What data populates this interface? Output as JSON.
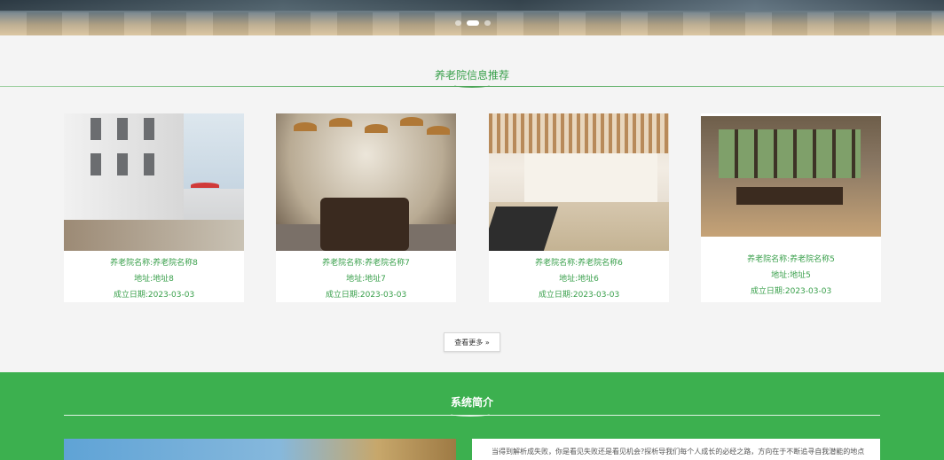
{
  "hero": {
    "slide_count": 3,
    "active_slide": 2
  },
  "recommend": {
    "title": "养老院信息推荐",
    "cards": [
      {
        "name": "养老院名称:养老院名称8",
        "address": "地址:地址8",
        "date": "成立日期:2023-03-03"
      },
      {
        "name": "养老院名称:养老院名称7",
        "address": "地址:地址7",
        "date": "成立日期:2023-03-03"
      },
      {
        "name": "养老院名称:养老院名称6",
        "address": "地址:地址6",
        "date": "成立日期:2023-03-03"
      },
      {
        "name": "养老院名称:养老院名称5",
        "address": "地址:地址5",
        "date": "成立日期:2023-03-03"
      }
    ],
    "more_label": "查看更多 »"
  },
  "intro": {
    "title": "系统简介",
    "text": "当得到解析成失败，你是看见失败还是看见机会?探析导我们每个人成长的必经之路，方向在于不断追寻自我潜能的地点"
  },
  "colors": {
    "accent": "#3cb04f",
    "text_green": "#3aa04c"
  }
}
